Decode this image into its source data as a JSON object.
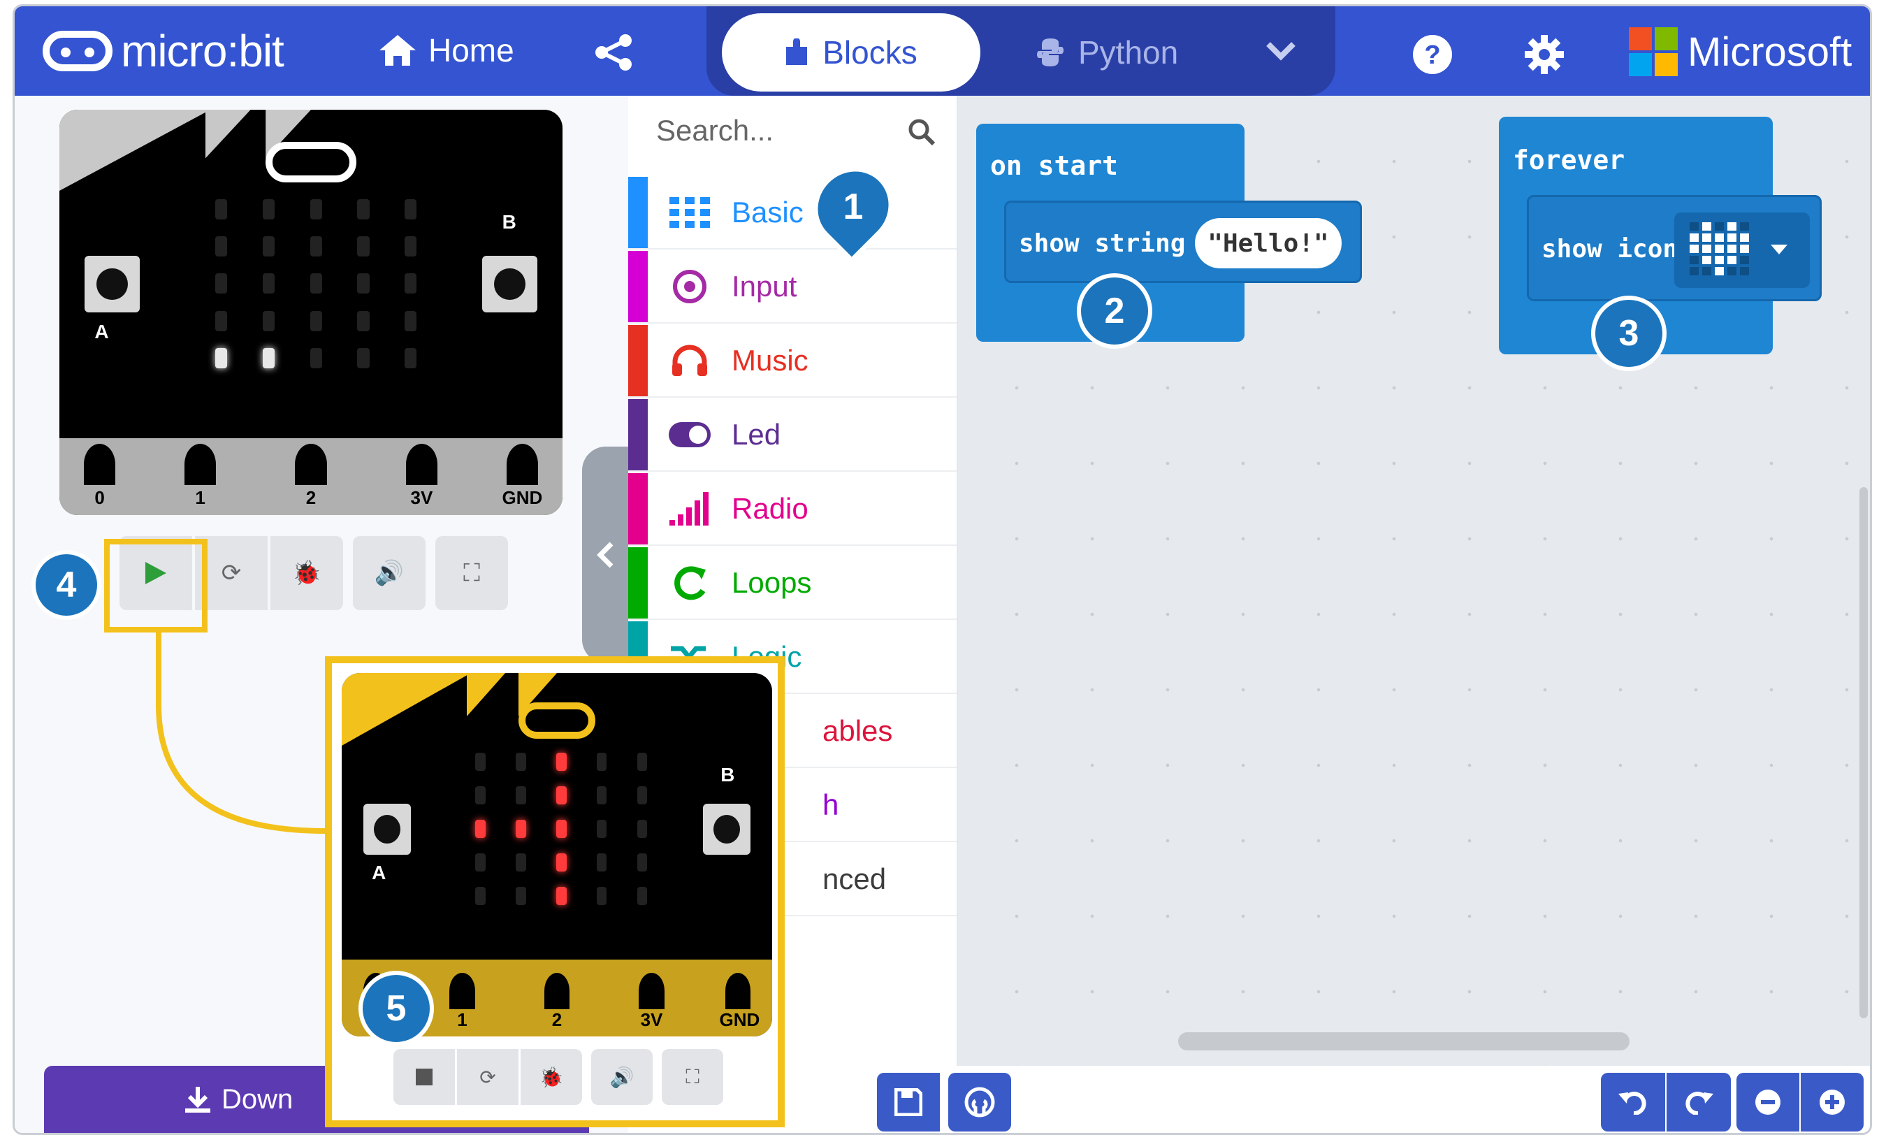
{
  "app": {
    "logo_text": "micro:bit",
    "brand": "Microsoft"
  },
  "nav": {
    "home_label": "Home"
  },
  "editor_modes": {
    "blocks_label": "Blocks",
    "python_label": "Python"
  },
  "toolbox": {
    "search_placeholder": "Search...",
    "categories": [
      {
        "label": "Basic",
        "color": "#1e90ff"
      },
      {
        "label": "Input",
        "color": "#d400d4"
      },
      {
        "label": "Music",
        "color": "#e63022"
      },
      {
        "label": "Led",
        "color": "#5c2d91"
      },
      {
        "label": "Radio",
        "color": "#e3008c"
      },
      {
        "label": "Loops",
        "color": "#00aa00"
      },
      {
        "label": "Logic",
        "color": "#00a4a6"
      },
      {
        "label": "ables",
        "color": "#dc143c"
      },
      {
        "label": "h",
        "color": "#9400d3"
      },
      {
        "label": "nced",
        "color": "#3c3c3c"
      }
    ]
  },
  "blocks": {
    "on_start": {
      "title": "on start",
      "inner_label": "show string",
      "string_value": "\"Hello!\""
    },
    "forever": {
      "title": "forever",
      "inner_label": "show icon"
    }
  },
  "simulator": {
    "pins": [
      "0",
      "1",
      "2",
      "3V",
      "GND"
    ],
    "button_a": "A",
    "button_b": "B"
  },
  "download": {
    "label": "Down"
  },
  "callouts": [
    "1",
    "2",
    "3",
    "4",
    "5"
  ],
  "colors": {
    "topbar": "#3454d1",
    "block": "#1f86d4",
    "highlight": "#f3c11b",
    "callout": "#1c75bc",
    "download": "#5c3ab2"
  }
}
